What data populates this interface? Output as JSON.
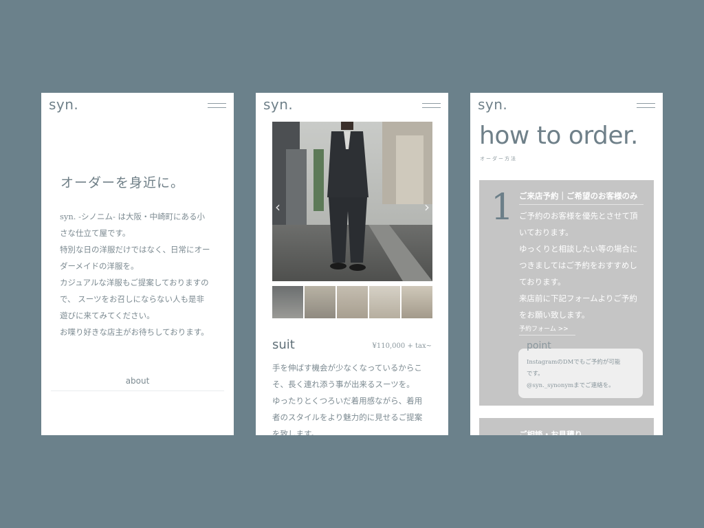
{
  "colors": {
    "background": "#6b818b",
    "accent": "#6f8089",
    "card": "#c5c5c5"
  },
  "screen1": {
    "logo": "syn.",
    "menu_icon": "hamburger-icon",
    "title": "オーダーを身近に。",
    "body": [
      "syn. -シノニム- は大阪・中崎町にある小",
      "さな仕立て屋です。",
      "特別な日の洋服だけではなく、日常にオー",
      "ダーメイドの洋服を。",
      "カジュアルな洋服もご提案しておりますの",
      "で、 スーツをお召しにならない人も是非",
      "遊びに来てみてください。",
      "お喋り好きな店主がお待ちしております。"
    ],
    "about_link": "about"
  },
  "screen2": {
    "logo": "syn.",
    "menu_icon": "hamburger-icon",
    "prev_arrow": "‹",
    "next_arrow": "›",
    "product_name": "suit",
    "price": "¥110,000 + tax~",
    "body": [
      "手を伸ばす機会が少なくなっているからこ",
      "そ、長く連れ添う事が出来るスーツを。",
      "ゆったりとくつろいだ着用感ながら、着用",
      "者のスタイルをより魅力的に見せるご提案",
      "を致します。"
    ]
  },
  "screen3": {
    "logo": "syn.",
    "menu_icon": "hamburger-icon",
    "heading": "how to order.",
    "subheading": "オーダー方法",
    "step1": {
      "number": "1",
      "title": "ご来店予約｜ご希望のお客様のみ",
      "body": [
        "ご予約のお客様を優先とさせて頂",
        "いております。",
        "ゆっくりと相談したい等の場合に",
        "つきましてはご予約をおすすめし",
        "ております。",
        "来店前に下記フォームよりご予約",
        "をお願い致します。"
      ],
      "form_link": "予約フォーム >>",
      "point_label": "point",
      "point_text": [
        "InstagramのDMでもご予約が可能",
        "です。",
        "@syn._synonymまでご連絡を。"
      ]
    },
    "step2": {
      "title": "ご相談・お見積り"
    }
  }
}
